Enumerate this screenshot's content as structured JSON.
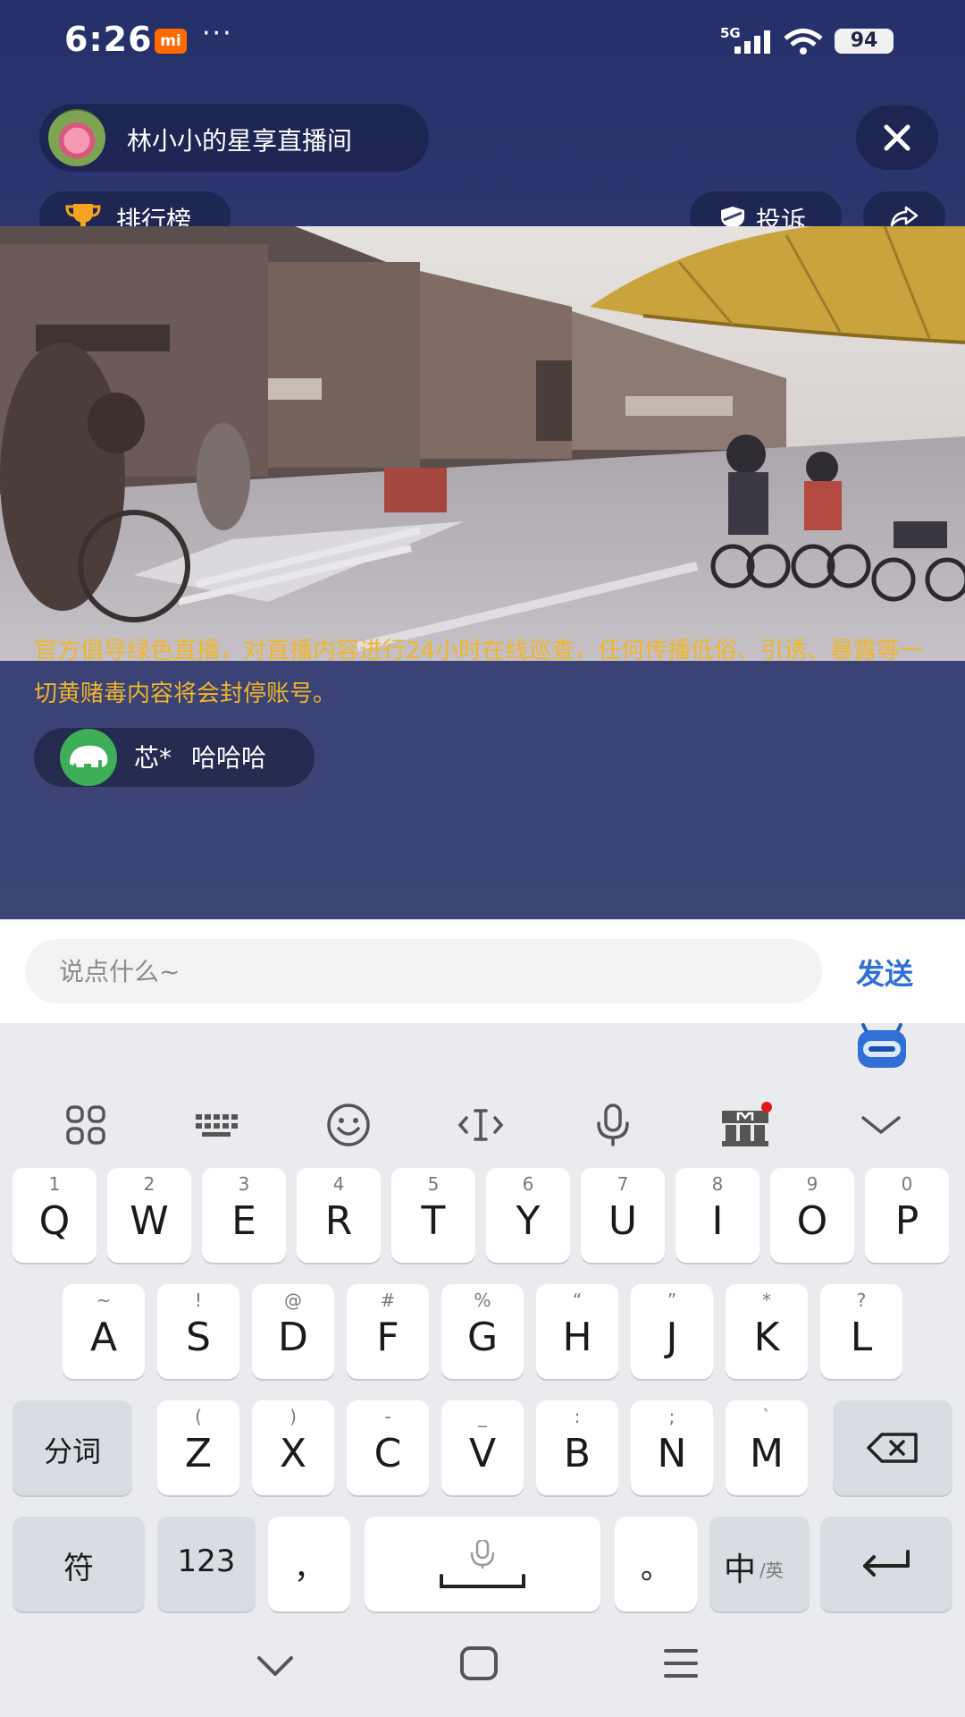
{
  "status_bar": {
    "time": "6:26",
    "mi_badge": "mi",
    "dots": "···",
    "network": "5G",
    "battery": "94"
  },
  "room": {
    "title": "林小小的星享直播间"
  },
  "actions": {
    "rank_label": "排行榜",
    "report_label": "投诉"
  },
  "notice": "官方倡导绿色直播，对直播内容进行24小时在线巡查，任何传播低俗、引诱、暴露等一切黄赌毒内容将会封停账号。",
  "comment": {
    "user": "芯*",
    "text": "哈哈哈"
  },
  "input": {
    "placeholder": "说点什么~",
    "send_label": "发送"
  },
  "keyboard": {
    "row1": [
      {
        "hint": "1",
        "key": "Q"
      },
      {
        "hint": "2",
        "key": "W"
      },
      {
        "hint": "3",
        "key": "E"
      },
      {
        "hint": "4",
        "key": "R"
      },
      {
        "hint": "5",
        "key": "T"
      },
      {
        "hint": "6",
        "key": "Y"
      },
      {
        "hint": "7",
        "key": "U"
      },
      {
        "hint": "8",
        "key": "I"
      },
      {
        "hint": "9",
        "key": "O"
      },
      {
        "hint": "0",
        "key": "P"
      }
    ],
    "row2": [
      {
        "hint": "~",
        "key": "A"
      },
      {
        "hint": "!",
        "key": "S"
      },
      {
        "hint": "@",
        "key": "D"
      },
      {
        "hint": "#",
        "key": "F"
      },
      {
        "hint": "%",
        "key": "G"
      },
      {
        "hint": "“",
        "key": "H"
      },
      {
        "hint": "”",
        "key": "J"
      },
      {
        "hint": "*",
        "key": "K"
      },
      {
        "hint": "?",
        "key": "L"
      }
    ],
    "row3": [
      {
        "hint": "(",
        "key": "Z"
      },
      {
        "hint": ")",
        "key": "X"
      },
      {
        "hint": "-",
        "key": "C"
      },
      {
        "hint": "_",
        "key": "V"
      },
      {
        "hint": ":",
        "key": "B"
      },
      {
        "hint": ";",
        "key": "N"
      },
      {
        "hint": "`",
        "key": "M"
      }
    ],
    "split_label": "分词",
    "symbol_label": "符",
    "num_label": "123",
    "comma_label": "，",
    "period_label": "。",
    "lang_label": "中",
    "lang_sub_label": "/英"
  },
  "colors": {
    "accent_blue": "#2f6fd6",
    "notice_gold": "#f0b52a",
    "mi_orange": "#ff6b00"
  }
}
